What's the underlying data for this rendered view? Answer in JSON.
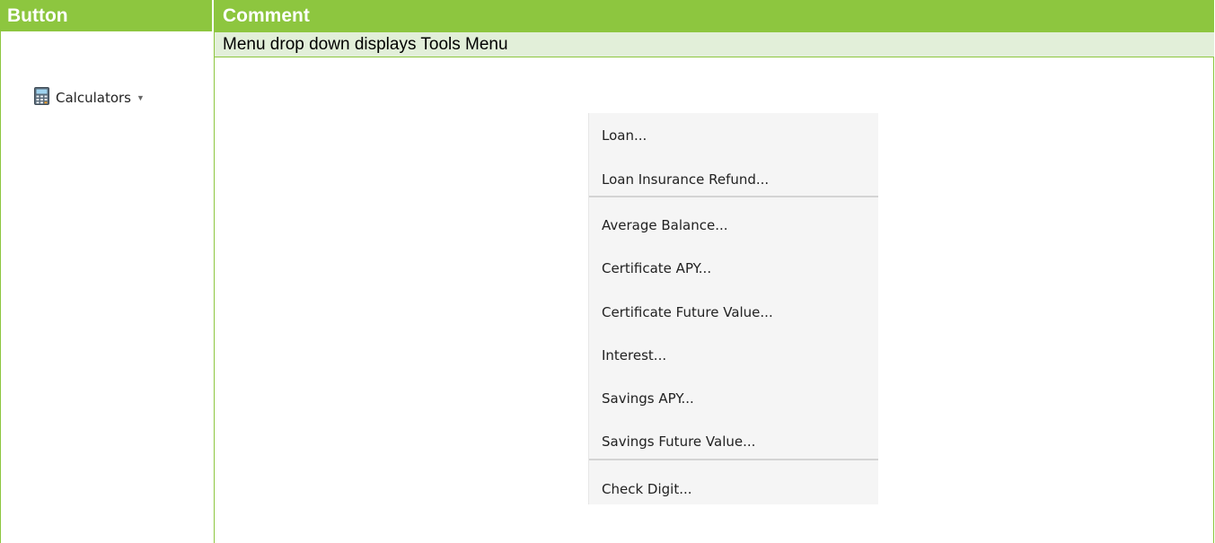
{
  "table": {
    "headers": {
      "button": "Button",
      "comment": "Comment"
    },
    "subheading": "Menu drop down displays Tools Menu",
    "colors": {
      "header_bg": "#8dc63f",
      "subrow_bg": "#e2efd9",
      "border": "#8dc63f"
    }
  },
  "toolbar_button": {
    "label": "Calculators",
    "icon": "calculator-icon",
    "caret": "▼"
  },
  "menu": {
    "items": [
      "Loan...",
      "Loan Insurance Refund...",
      "Average Balance...",
      "Certificate APY...",
      "Certificate Future Value...",
      "Interest...",
      "Savings APY...",
      "Savings Future Value...",
      "Check Digit..."
    ]
  }
}
